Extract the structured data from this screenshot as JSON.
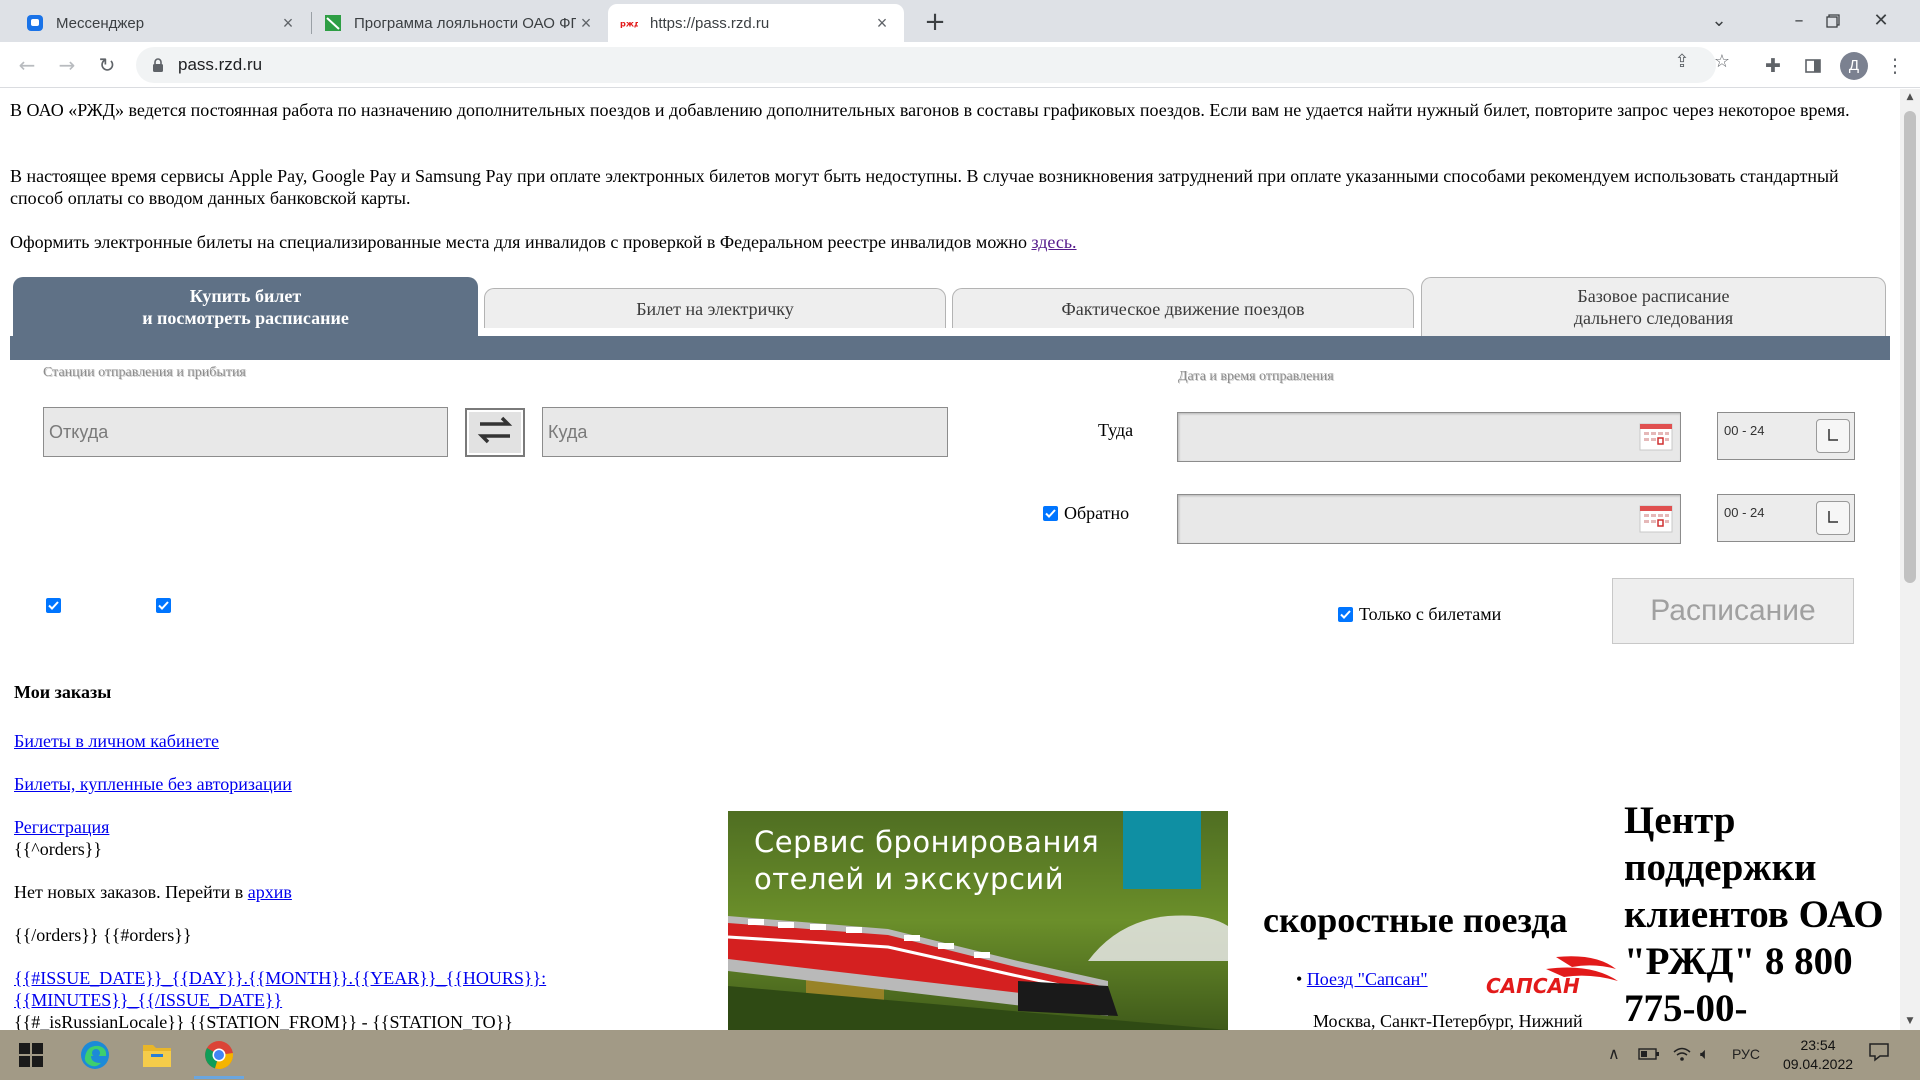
{
  "browser": {
    "tabs": [
      {
        "title": "Мессенджер",
        "favicon": "messenger-icon"
      },
      {
        "title": "Программа лояльности ОАО ФПК",
        "favicon": "loyalty-site-icon"
      },
      {
        "title": "https://pass.rzd.ru",
        "favicon": "rzd-logo-icon"
      }
    ],
    "new_tab": "+",
    "url": "pass.rzd.ru",
    "profile_initial": "Д"
  },
  "notices": {
    "p1": "В ОАО «РЖД» ведется постоянная работа по назначению дополнительных поездов и добавлению дополнительных вагонов в составы графиковых поездов. Если вам не удается найти нужный билет, повторите запрос через некоторое время.",
    "p2": "В настоящее время сервисы Apple Pay, Google Pay и Samsung Pay при оплате электронных билетов могут быть недоступны. В случае возникновения затруднений при оплате указанными способами рекомендуем использовать стандартный способ оплаты со вводом данных банковской карты.",
    "p3_text": "Оформить электронные билеты на специализированные места для инвалидов с проверкой в Федеральном реестре инвалидов можно ",
    "p3_link": "здесь."
  },
  "rzd_tabs": [
    {
      "line1": "Купить билет",
      "line2": "и посмотреть расписание"
    },
    {
      "line1": "Билет на электричку",
      "line2": ""
    },
    {
      "line1": "Фактическое движение поездов",
      "line2": ""
    },
    {
      "line1": "Базовое расписание",
      "line2": "дальнего следования"
    }
  ],
  "search_form": {
    "stations_label": "Станции отправления и прибытия",
    "from_placeholder": "Откуда",
    "to_placeholder": "Куда",
    "datetime_label": "Дата и время отправления",
    "there_label": "Туда",
    "back_label": "Обратно",
    "time_range_there": "00 - 24",
    "time_range_back": "00 - 24",
    "only_with_tickets_label": "Только с билетами",
    "schedule_button": "Расписание",
    "back_checked": true,
    "only_with_tickets_checked": true
  },
  "orders": {
    "title": "Мои заказы",
    "link_cabinet": "Билеты в личном кабинете",
    "link_no_auth": "Билеты, купленные без авторизации",
    "link_registration": "Регистрация",
    "tpl1": "{{^orders}}",
    "no_new_text": "Нет новых заказов. Перейти в ",
    "archive_link": "архив",
    "tpl2": "{{/orders}} {{#orders}}",
    "issue_date_line1": "{{#ISSUE_DATE}}_{{DAY}}.{{MONTH}}.{{YEAR}}_{{HOURS}}:",
    "issue_date_line2": "{{MINUTES}}_{{/ISSUE_DATE}}",
    "stations_tpl": "{{#_isRussianLocale}} {{STATION_FROM}} - {{STATION_TO}}"
  },
  "banner": {
    "line1": "Сервис бронирования",
    "line2": "отелей и экскурсий"
  },
  "fast_trains": {
    "title": "скоростные поезда",
    "sapsan_link": "Поезд \"Сапсан\"",
    "sapsan_desc": "Москва, Санкт-Петербург, Нижний",
    "sapsan_logo_text": "САПСАН"
  },
  "support": {
    "title": "Центр поддержки клиентов ОАО \"РЖД\" 8 800 775-00-"
  },
  "taskbar": {
    "language": "РУС",
    "time": "23:54",
    "date": "09.04.2022"
  },
  "colors": {
    "rzd_tab_active": "#5f7186",
    "link": "#0000ee",
    "checkbox": "#0075ff"
  }
}
